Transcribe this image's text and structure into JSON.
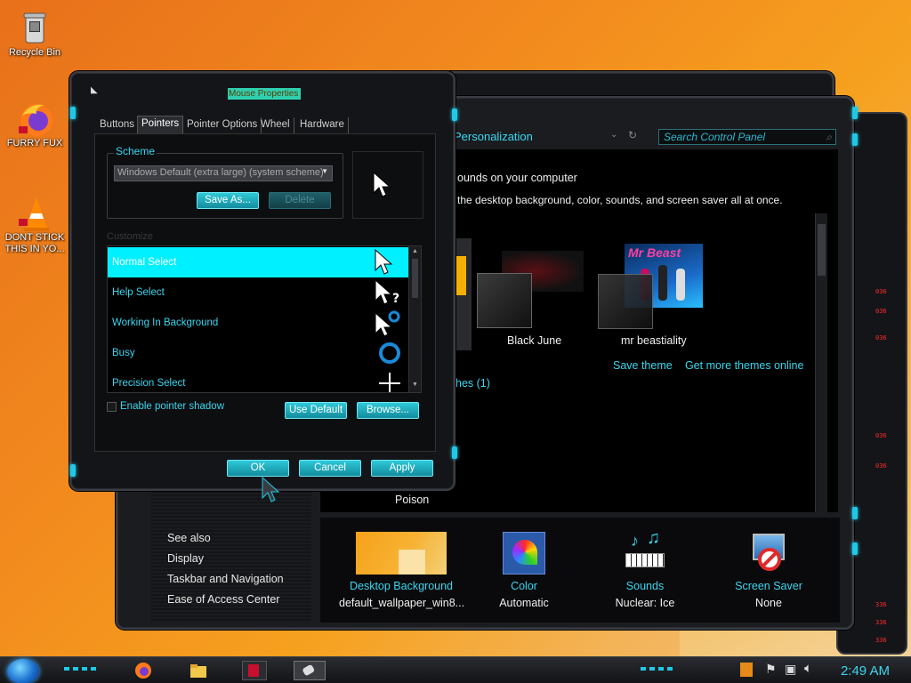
{
  "desktop": {
    "icons": [
      {
        "label": "Recycle Bin",
        "icon": "recycle-bin-icon"
      },
      {
        "label": "FURRY FUX",
        "icon": "firefox-icon"
      },
      {
        "label": "DONT STICK THIS IN YO...",
        "icon": "vlc-icon"
      }
    ]
  },
  "personalization": {
    "address": "Personalization",
    "search_placeholder": "Search Control Panel",
    "heading": "ounds on your computer",
    "description": "the desktop background, color, sounds, and screen saver all at once.",
    "themes": [
      {
        "name": "Black June"
      },
      {
        "name": "mr beastiality",
        "thumb_text": "Mr Beast"
      }
    ],
    "save_theme": "Save theme",
    "get_more_themes": "Get more themes online",
    "installed_themes": "hes (1)",
    "poison_label": "Poison",
    "see_also": {
      "title": "See also",
      "links": [
        "Display",
        "Taskbar and Navigation",
        "Ease of Access Center"
      ]
    },
    "bottom": [
      {
        "label": "Desktop Background",
        "value": "default_wallpaper_win8...",
        "icon": "desktop-background-icon"
      },
      {
        "label": "Color",
        "value": "Automatic",
        "icon": "color-icon"
      },
      {
        "label": "Sounds",
        "value": "Nuclear: Ice",
        "icon": "sounds-icon"
      },
      {
        "label": "Screen Saver",
        "value": "None",
        "icon": "screen-saver-icon"
      }
    ]
  },
  "mouse": {
    "title": "Mouse Properties",
    "tabs": [
      "Buttons",
      "Pointers",
      "Pointer Options",
      "Wheel",
      "Hardware"
    ],
    "active_tab": "Pointers",
    "scheme_label": "Scheme",
    "scheme_value": "Windows Default (extra large) (system scheme)",
    "save_as": "Save As...",
    "delete": "Delete",
    "customize_label": "Customize",
    "pointers": [
      {
        "name": "Normal Select",
        "icon": "arrow-cursor-icon",
        "selected": true
      },
      {
        "name": "Help Select",
        "icon": "help-cursor-icon",
        "selected": false
      },
      {
        "name": "Working In Background",
        "icon": "working-cursor-icon",
        "selected": false
      },
      {
        "name": "Busy",
        "icon": "busy-cursor-icon",
        "selected": false
      },
      {
        "name": "Precision Select",
        "icon": "crosshair-cursor-icon",
        "selected": false
      }
    ],
    "shadow_label": "Enable pointer shadow",
    "shadow_checked": false,
    "use_default": "Use Default",
    "browse": "Browse...",
    "ok": "OK",
    "cancel": "Cancel",
    "apply": "Apply"
  },
  "taskbar": {
    "time": "2:49 AM"
  },
  "colors": {
    "accent": "#3ad6ef",
    "selection": "#00f0ff"
  }
}
